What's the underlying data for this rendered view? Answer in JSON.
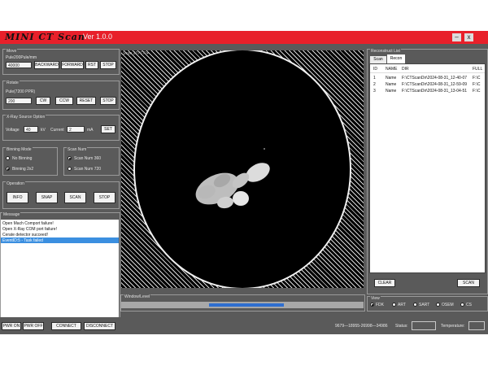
{
  "window": {
    "logo": "MINI CT Scan",
    "version": "Ver 1.0.0",
    "minimize": "–",
    "close": "x"
  },
  "move": {
    "title": "Move",
    "pulse_label": "Pule200Pule/mm",
    "pulse_value": "40000",
    "backward": "BACKWARD",
    "forward": "FORWARD",
    "rst": "RST",
    "stop": "STOP"
  },
  "rotate": {
    "title": "Rotate",
    "pulse_label": "Pule(7200 PPR)",
    "pulse_value": "200",
    "cw": "CW",
    "ccw": "CCW",
    "reset": "RESET",
    "stop": "STOP"
  },
  "xray": {
    "title": "X-Ray Source Option",
    "voltage_label": "Voltage",
    "voltage_value": "40",
    "voltage_unit": "kV",
    "current_label": "Current",
    "current_value": "2",
    "current_unit": "mA",
    "set": "SET"
  },
  "binning": {
    "title": "Binning Mode",
    "opt1": "No Binning",
    "opt2": "Binning 2x2"
  },
  "scannum": {
    "title": "Scan Num",
    "opt1": "Scan Num 360",
    "opt2": "Scan Num 720"
  },
  "operation": {
    "title": "Operation",
    "info": "INFO",
    "snap": "SNAP",
    "scan": "SCAN",
    "stop": "STOP"
  },
  "message": {
    "title": "Message",
    "lines": [
      "Open Mach Comport failure!",
      "Open X-Ray COM port failure!",
      "Cerate detector succeed!",
      "EventID:5 - Task failed"
    ]
  },
  "viewer": {
    "overlay": "Scan 2076 R4"
  },
  "window_level": {
    "title": "Window/Level"
  },
  "recon": {
    "title": "Reconstruct List",
    "tab_scan": "Scan",
    "tab_recon": "Recon",
    "headers": [
      "ID",
      "NAME",
      "DIR",
      "FULL"
    ],
    "rows": [
      [
        "1",
        "Name",
        "F:\\CTScanDir\\2024-08-31_12-40-07",
        "F:\\C"
      ],
      [
        "2",
        "Name",
        "F:\\CTScanDir\\2024-08-31_12-59-09",
        "F:\\C"
      ],
      [
        "3",
        "Name",
        "F:\\CTScanDir\\2024-08-31_13-04-51",
        "F:\\C"
      ]
    ],
    "clear": "CLEAR",
    "scan": "SCAN"
  },
  "view": {
    "title": "View",
    "options": [
      "FDK",
      "ART",
      "SART",
      "OSEM",
      "CS"
    ]
  },
  "bottom": {
    "pwr_on": "PWR ON",
    "pwr_off": "PWR OFF",
    "connect": "CONNECT",
    "disconnect": "DISCONNECT",
    "code": "9679—18955-26998—34986",
    "status_label": "Status:",
    "temp_label": "Temperature:"
  }
}
